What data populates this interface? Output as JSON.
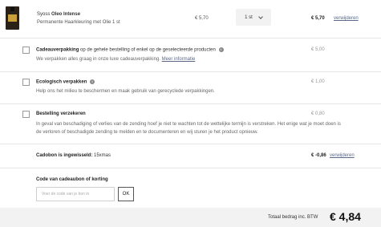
{
  "product": {
    "brand": "Syoss",
    "name": "Oleo Intense",
    "description": "Permanente Haarkleuring met Olie 1 st",
    "unit_price": "€ 5,70",
    "quantity": "1 st",
    "total": "€ 5,70",
    "remove_label": "verwijderen"
  },
  "options": {
    "gift_wrap": {
      "title": "Cadeauverpakking",
      "title_suffix": "op de gehele bestelling of enkel op de geselecteerde producten",
      "description": "We verpakken alles graag in onze luxe cadeauverpakking.",
      "more_info": "Meer informatie",
      "price": "€ 5,00"
    },
    "eco": {
      "title": "Ecologisch verpakken",
      "description": "Help ons het milieu te beschermen en maak gebruik van gerecyclede verpakkingen.",
      "price": "€ 1,00"
    },
    "insurance": {
      "title": "Bestelling verzekeren",
      "description": "In geval van beschadiging of verlies van de zending hoef je niet te wachten tot de wettelijke termijn is verstreken. Het enige wat je moet doen is de verloren of beschadigde zending te melden en te documenteren en wij sturen je het product opnieuw.",
      "price": "€ 0,80"
    }
  },
  "coupon": {
    "label": "Cadobon is ingewisseld:",
    "code": "15xmas",
    "value": "€ -0,86",
    "remove_label": "verwijderen"
  },
  "discount": {
    "title": "Code van cadeaubon of korting",
    "placeholder": "Voer de code van je bon in",
    "button_label": "OK"
  },
  "totals": {
    "label": "Totaal bedrag inc. BTW",
    "value": "€ 4,84"
  },
  "colors": {
    "link": "#5a6a88",
    "total_bar_bg": "#f2f2f2",
    "quantity_bg": "#f2f2f2"
  }
}
